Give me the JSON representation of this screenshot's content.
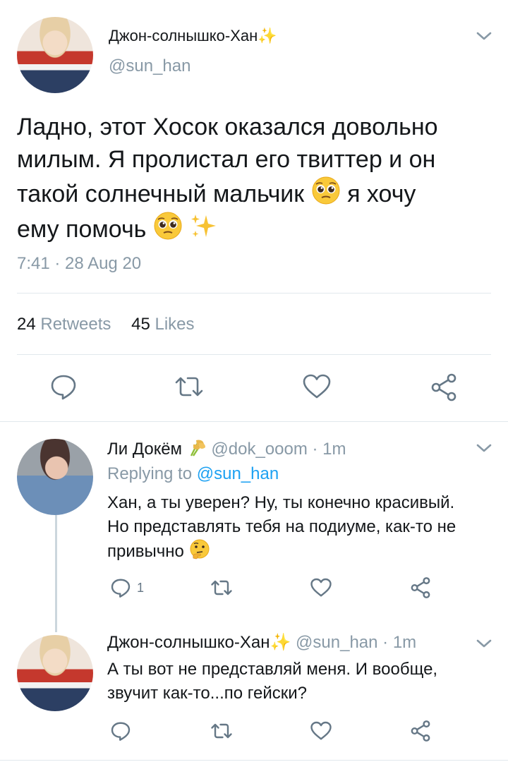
{
  "main_tweet": {
    "author": {
      "name": "Джон-солнышко-Хан",
      "name_emoji": "✨",
      "handle": "@sun_han"
    },
    "text_line1": "Ладно, этот Хосок оказался довольно",
    "text_line2": "милым. Я пролистал его твиттер и он",
    "text_line3_a": "такой солнечный мальчик",
    "text_line3_b": "я хочу",
    "text_line4": "ему помочь",
    "time": "7:41 · 28 Aug 20",
    "retweets_count": "24",
    "retweets_label": "Retweets",
    "likes_count": "45",
    "likes_label": "Likes"
  },
  "replies": [
    {
      "name": "Ли Докём",
      "name_emoji": "rice-sheaf",
      "handle": "@dok_ooom",
      "time": "· 1m",
      "replying_label": "Replying to",
      "replying_to": "@sun_han",
      "line1": "Хан, а ты уверен? Ну, ты конечно красивый.",
      "line2": "Но представлять тебя на подиуме, как-то не",
      "line3": "привычно",
      "reply_count": "1"
    },
    {
      "name": "Джон-солнышко-Хан",
      "name_emoji": "✨",
      "handle": "@sun_han",
      "time": "· 1m",
      "line1": "А ты вот не представляй меня. И вообще,",
      "line2": "звучит как-то...по гейски?"
    }
  ],
  "colors": {
    "text": "#14171a",
    "secondary": "#8899a6",
    "link": "#1da1f2",
    "divider": "#e1e8ed",
    "icon": "#657786"
  },
  "icons": [
    "reply-icon",
    "retweet-icon",
    "like-icon",
    "share-icon",
    "chevron-down-icon",
    "pleading-face-emoji",
    "sparkles-emoji",
    "thinking-face-emoji",
    "rice-sheaf-emoji"
  ]
}
